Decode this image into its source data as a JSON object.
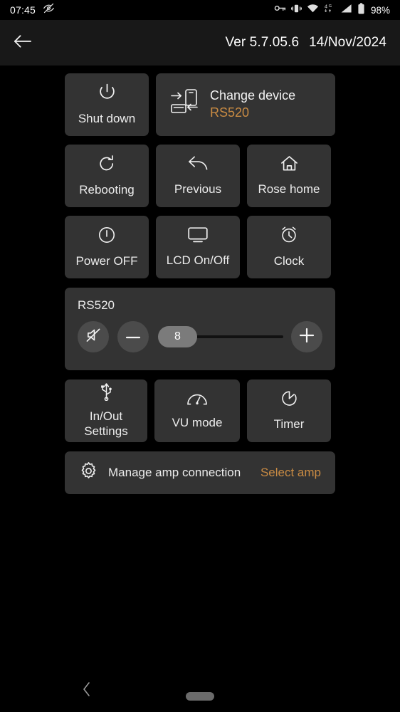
{
  "statusbar": {
    "time": "07:45",
    "eye_off_icon": "eye-off-icon",
    "key_icon": "vpn-key-icon",
    "vibrate_icon": "vibrate-icon",
    "wifi_icon": "wifi-icon",
    "network_type": "4G",
    "signal_icon": "signal-bars-icon",
    "battery_icon": "battery-full-icon",
    "battery_percent": "98%"
  },
  "header": {
    "back_icon": "arrow-left-icon",
    "version": "Ver 5.7.05.6",
    "date": "14/Nov/2024"
  },
  "colors": {
    "accent": "#c98b43",
    "card": "#333333",
    "background": "#000000",
    "header": "#181818",
    "circle_button": "#4b4b4b",
    "slider_thumb": "#7b7b7b",
    "slider_track": "#111111"
  },
  "main": {
    "row1": {
      "shutdown": {
        "label": "Shut down",
        "icon": "power-icon"
      },
      "change_device": {
        "title": "Change device",
        "device": "RS520",
        "icon": "change-device-icon"
      }
    },
    "row2": [
      {
        "label": "Rebooting",
        "icon": "refresh-icon"
      },
      {
        "label": "Previous",
        "icon": "reply-arrow-icon"
      },
      {
        "label": "Rose home",
        "icon": "home-icon"
      }
    ],
    "row3": [
      {
        "label": "Power OFF",
        "icon": "power-circle-icon"
      },
      {
        "label": "LCD On/Off",
        "icon": "monitor-icon"
      },
      {
        "label": "Clock",
        "icon": "alarm-clock-icon"
      }
    ],
    "volume": {
      "device_name": "RS520",
      "mute_icon": "volume-mute-icon",
      "minus_icon": "minus-icon",
      "plus_icon": "plus-icon",
      "value": "8",
      "min": 0,
      "max": 100,
      "fill_percent": 8
    },
    "row5": [
      {
        "label": "In/Out\nSettings",
        "line1": "In/Out",
        "line2": "Settings",
        "icon": "usb-icon"
      },
      {
        "label": "VU mode",
        "icon": "gauge-icon"
      },
      {
        "label": "Timer",
        "icon": "timer-icon"
      }
    ],
    "manage_amp": {
      "icon": "gear-icon",
      "label": "Manage amp connection",
      "action": "Select amp"
    }
  },
  "navbar": {
    "back_icon": "nav-back-chevron-icon",
    "home_icon": "nav-home-pill-icon"
  }
}
